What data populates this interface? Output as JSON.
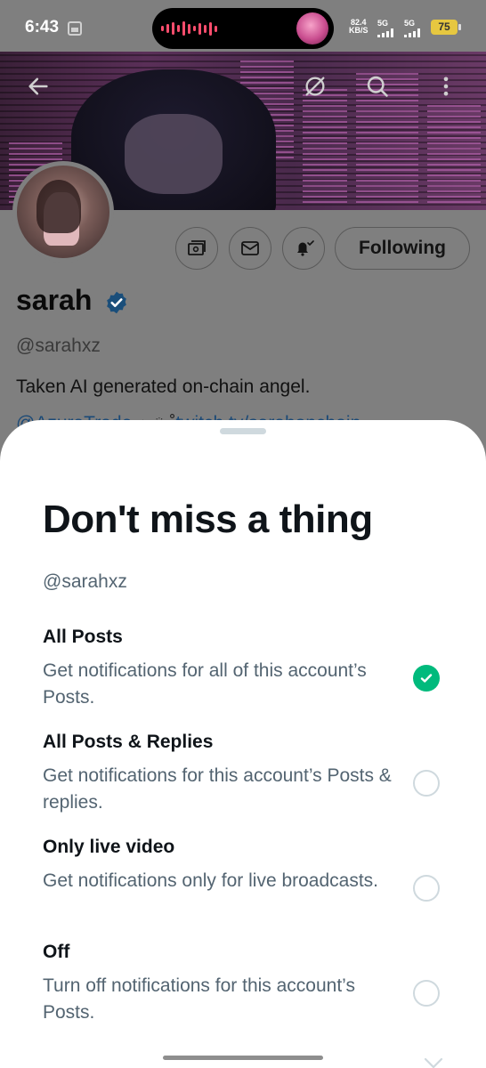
{
  "status_bar": {
    "time": "6:43",
    "speed_value": "82.4",
    "speed_unit": "KB/S",
    "signal1": "5G",
    "signal2": "5G",
    "battery": "75"
  },
  "profile": {
    "display_name": "sarah",
    "handle": "@sarahxz",
    "bio": "Taken AI generated on-chain angel.",
    "bio_link1": "@AzuraTrade",
    "bio_sep": " ⋆ ༘ ˚",
    "bio_link2": "twitch.tv/sarahonchain",
    "following_label": "Following"
  },
  "sheet": {
    "title": "Don't miss a thing",
    "handle": "@sarahxz",
    "selected_option": "All Posts",
    "options": [
      {
        "title": "All Posts",
        "desc": "Get notifications for all of this account’s Posts."
      },
      {
        "title": "All Posts & Replies",
        "desc": "Get notifications for this account’s Posts & replies."
      },
      {
        "title": "Only live video",
        "desc": "Get notifications only for live broadcasts."
      },
      {
        "title": "Off",
        "desc": "Turn off notifications for this account’s Posts."
      }
    ]
  },
  "colors": {
    "accent_green": "#00ba7c",
    "verified_blue": "#1d9bf0",
    "text_primary": "#0f1419",
    "text_secondary": "#536471"
  },
  "icons": [
    "back-arrow-icon",
    "grok-icon",
    "search-icon",
    "more-vertical-icon",
    "subscribe-icon",
    "mail-icon",
    "bell-check-icon",
    "verified-badge-icon",
    "checkmark-icon"
  ]
}
